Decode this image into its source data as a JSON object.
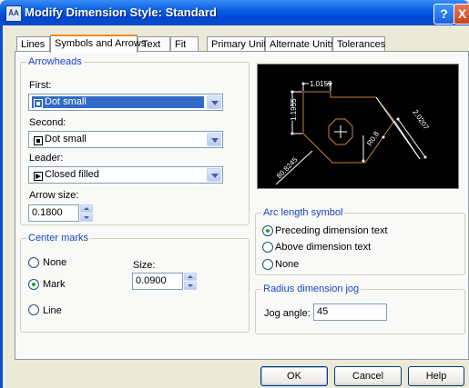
{
  "window": {
    "title": "Modify Dimension Style: Standard",
    "icon_text": "ĀA"
  },
  "title_buttons": {
    "help": "?",
    "close": "X"
  },
  "tabs": [
    {
      "label": "Lines"
    },
    {
      "label": "Symbols and Arrows"
    },
    {
      "label": "Text"
    },
    {
      "label": "Fit"
    },
    {
      "label": "Primary Units"
    },
    {
      "label": "Alternate Units"
    },
    {
      "label": "Tolerances"
    }
  ],
  "active_tab": "Symbols and Arrows",
  "arrowheads": {
    "legend": "Arrowheads",
    "first_label": "First:",
    "first_value": "Dot small",
    "second_label": "Second:",
    "second_value": "Dot small",
    "leader_label": "Leader:",
    "leader_value": "Closed filled",
    "arrow_size_label": "Arrow size:",
    "arrow_size_value": "0.1800"
  },
  "center_marks": {
    "legend": "Center marks",
    "none_label": "None",
    "mark_label": "Mark",
    "line_label": "Line",
    "selected": "Mark",
    "size_label": "Size:",
    "size_value": "0.0900"
  },
  "preview": {
    "dim_top": "1.0159",
    "dim_left": "1.1955",
    "dim_right": "2.0207",
    "dim_diag": "80.8245",
    "dim_radius": "R0.8"
  },
  "arc_length": {
    "legend": "Arc length symbol",
    "preceding_label": "Preceding dimension text",
    "above_label": "Above dimension text",
    "none_label": "None",
    "selected": "Preceding dimension text"
  },
  "radius_jog": {
    "legend": "Radius dimension jog",
    "jog_label": "Jog angle:",
    "jog_value": "45"
  },
  "buttons": {
    "ok": "OK",
    "cancel": "Cancel",
    "help": "Help"
  },
  "colors": {
    "title_bar": "#0a4ec8",
    "group_legend": "#1a44c6",
    "selection": "#316ac5",
    "preview_bg": "#000000",
    "preview_shape": "#c8823c"
  }
}
